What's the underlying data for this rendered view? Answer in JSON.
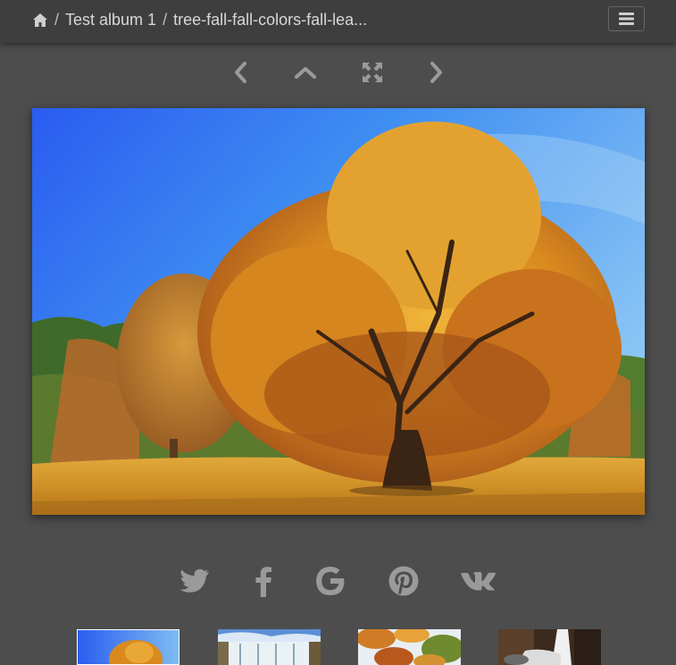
{
  "header": {
    "breadcrumb": {
      "album": "Test album 1",
      "separator": "/",
      "current": "tree-fall-fall-colors-fall-lea..."
    },
    "home_icon": "home-icon",
    "menu_icon": "hamburger-menu-icon"
  },
  "navigation": {
    "previous_icon": "chevron-left-icon",
    "up_icon": "chevron-up-icon",
    "fullscreen_icon": "expand-icon",
    "next_icon": "chevron-right-icon"
  },
  "photo": {
    "subject": "autumn-tree-photo"
  },
  "share": {
    "items": [
      "twitter-icon",
      "facebook-icon",
      "google-icon",
      "pinterest-icon",
      "vk-icon"
    ]
  },
  "thumbnails": {
    "items": [
      "autumn-tree-thumb",
      "waterfall-thumb",
      "autumn-leaves-thumb",
      "forest-stream-thumb"
    ],
    "active_index": 0
  },
  "colors": {
    "background": "#4d4d4d",
    "header": "#3e3e3e",
    "icon": "#9a9a9a",
    "text": "#d8d8d8"
  }
}
